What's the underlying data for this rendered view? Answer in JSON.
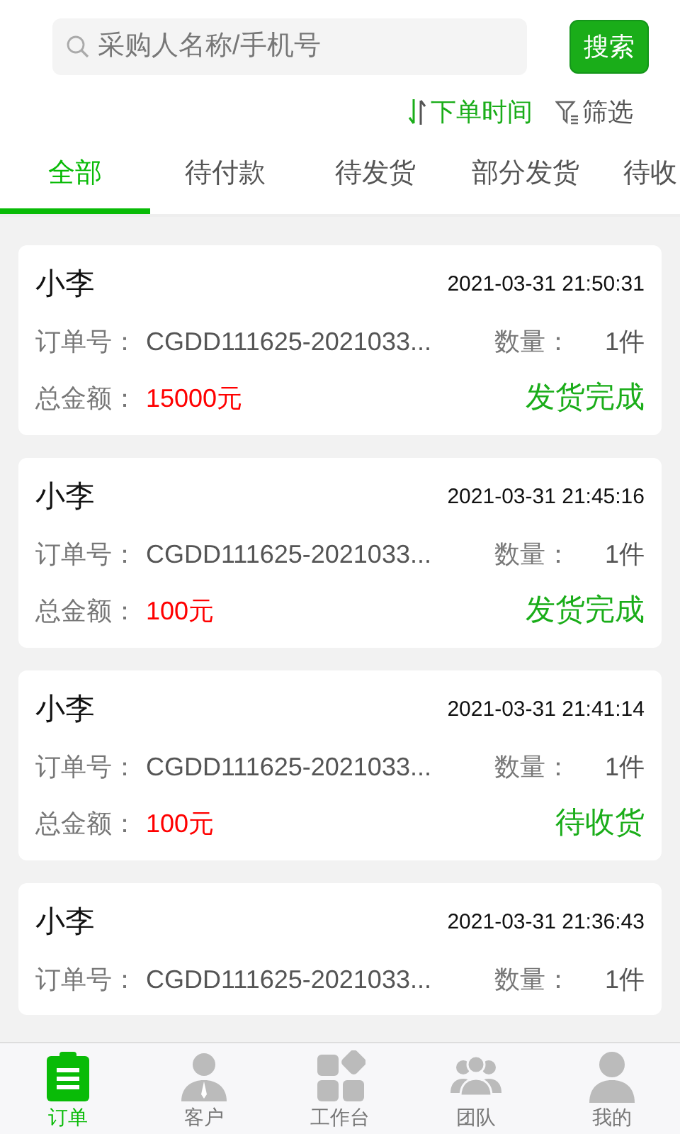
{
  "search": {
    "placeholder": "采购人名称/手机号",
    "button": "搜索"
  },
  "sort": [
    {
      "label": "下单时间",
      "kind": "sort",
      "active": true
    },
    {
      "label": "筛选",
      "kind": "filter",
      "active": false
    }
  ],
  "tabs": [
    {
      "label": "全部",
      "selected": true
    },
    {
      "label": "待付款",
      "selected": false
    },
    {
      "label": "待发货",
      "selected": false
    },
    {
      "label": "部分发货",
      "selected": false
    },
    {
      "label": "待收",
      "selected": false
    }
  ],
  "orders": [
    {
      "buyer": "小李",
      "time": "2021-03-31 21:50:31",
      "order_label": "订单号：",
      "order_no": "CGDD111625-2021033...",
      "qty_label": "数量：",
      "qty": "1件",
      "amount_label": "总金额：",
      "amount": "15000元",
      "status": "发货完成"
    },
    {
      "buyer": "小李",
      "time": "2021-03-31 21:45:16",
      "order_label": "订单号：",
      "order_no": "CGDD111625-2021033...",
      "qty_label": "数量：",
      "qty": "1件",
      "amount_label": "总金额：",
      "amount": "100元",
      "status": "发货完成"
    },
    {
      "buyer": "小李",
      "time": "2021-03-31 21:41:14",
      "order_label": "订单号：",
      "order_no": "CGDD111625-2021033...",
      "qty_label": "数量：",
      "qty": "1件",
      "amount_label": "总金额：",
      "amount": "100元",
      "status": "待收货"
    },
    {
      "buyer": "小李",
      "time": "2021-03-31 21:36:43",
      "order_label": "订单号：",
      "order_no": "CGDD111625-2021033...",
      "qty_label": "数量：",
      "qty": "1件"
    }
  ],
  "nav": [
    {
      "label": "订单",
      "kind": "orders",
      "selected": true
    },
    {
      "label": "客户",
      "kind": "customer",
      "selected": false
    },
    {
      "label": "工作台",
      "kind": "workbench",
      "selected": false
    },
    {
      "label": "团队",
      "kind": "team",
      "selected": false
    },
    {
      "label": "我的",
      "kind": "me",
      "selected": false
    }
  ]
}
